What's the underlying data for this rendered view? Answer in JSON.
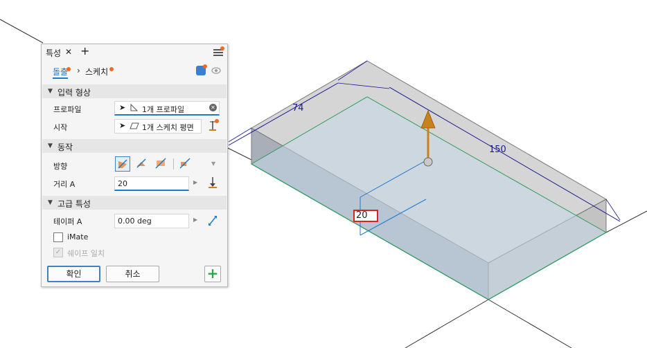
{
  "panel": {
    "tab_title": "특성",
    "close_glyph": "✕",
    "add_glyph": "+",
    "breadcrumb": {
      "tool": "돌출",
      "sep": "›",
      "sketch": "스케치"
    },
    "sections": {
      "input": "입력 형상",
      "behavior": "동작",
      "advanced": "고급 특성"
    },
    "profile": {
      "label": "프로파일",
      "value": "1개 프로파일"
    },
    "start": {
      "label": "시작",
      "value": "1개 스케치 평면"
    },
    "direction": {
      "label": "방향"
    },
    "distance": {
      "label": "거리 A",
      "value": "20"
    },
    "taper": {
      "label": "테이퍼 A",
      "value": "0.00 deg"
    },
    "imate": {
      "label": "iMate",
      "checked": false
    },
    "match_shape": {
      "label": "쉐이프 일치",
      "checked": true,
      "disabled": true
    },
    "ok_label": "확인",
    "cancel_label": "취소",
    "plus_label": "+"
  },
  "viewport": {
    "dim_74": "74",
    "dim_150": "150",
    "distance_input": "20"
  },
  "colors": {
    "accent": "#1c79c9",
    "notification": "#f26a21",
    "arrow": "#c8811c",
    "dimension": "#1a1a8c"
  }
}
